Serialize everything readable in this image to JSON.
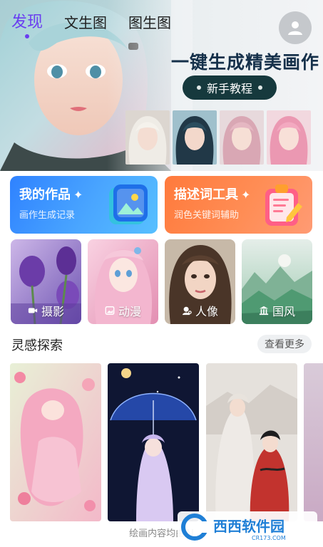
{
  "header": {
    "tabs": [
      {
        "label": "发现",
        "active": true
      },
      {
        "label": "文生图",
        "active": false
      },
      {
        "label": "图生图",
        "active": false
      }
    ],
    "avatar_icon": "user-icon"
  },
  "hero": {
    "title": "一键生成精美画作",
    "button_label": "新手教程"
  },
  "tools": [
    {
      "title": "我的作品",
      "subtitle": "画作生成记录",
      "icon": "gallery-icon"
    },
    {
      "title": "描述词工具",
      "subtitle": "润色关键词辅助",
      "icon": "clipboard-edit-icon"
    }
  ],
  "categories": [
    {
      "label": "摄影",
      "icon": "video-camera-icon"
    },
    {
      "label": "动漫",
      "icon": "image-icon"
    },
    {
      "label": "人像",
      "icon": "portrait-icon"
    },
    {
      "label": "国风",
      "icon": "temple-icon"
    }
  ],
  "inspiration": {
    "title": "灵感探索",
    "more_label": "查看更多"
  },
  "footer_note": "绘画内容均由AI",
  "watermark": {
    "text": "西西软件园",
    "sub": "CR173.COM"
  },
  "colors": {
    "accent": "#6a3df0",
    "works_card": "#3b92ff",
    "prompt_card": "#ff8550",
    "tutorial_button": "#16393d"
  }
}
